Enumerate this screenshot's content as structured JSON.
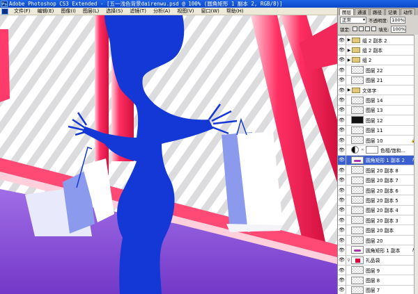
{
  "window": {
    "title": "Adobe Photoshop CS3 Extended - [五一浅色背景dairenwu.psd @ 100% (圆角矩形 1 副本 2, RGB/8)]",
    "app_icon": "ps-icon"
  },
  "menu": [
    "文件(F)",
    "编辑(E)",
    "图像(I)",
    "图层(L)",
    "选择(S)",
    "滤镜(T)",
    "分析(A)",
    "视图(V)",
    "窗口(W)",
    "帮助(H)"
  ],
  "panel": {
    "tabs": [
      "图层",
      "通道",
      "路径",
      "记录",
      "动作"
    ],
    "active_tab": "图层",
    "blend_mode": "正常",
    "opacity_label": "不透明度:",
    "opacity_value": "100%",
    "lock_label": "锁定:",
    "fill_label": "填充:",
    "fill_value": "100%"
  },
  "layers": [
    {
      "name": "组 2 副本 2",
      "kind": "group"
    },
    {
      "name": "组 2 副本",
      "kind": "group"
    },
    {
      "name": "组 2",
      "kind": "group"
    },
    {
      "name": "图层 22",
      "kind": "layer"
    },
    {
      "name": "图层 21",
      "kind": "layer"
    },
    {
      "name": "文体字",
      "kind": "group"
    },
    {
      "name": "图层 14",
      "kind": "layer"
    },
    {
      "name": "图层 13",
      "kind": "layer"
    },
    {
      "name": "图层 12",
      "kind": "masked"
    },
    {
      "name": "图层 11",
      "kind": "layer"
    },
    {
      "name": "图层 10",
      "kind": "layer-locked"
    },
    {
      "name": "色相/饱和...",
      "kind": "adjust"
    },
    {
      "name": "圆角矩形 1 副本 2",
      "kind": "shape",
      "selected": true,
      "fx": "fx"
    },
    {
      "name": "图层 20 副本 8",
      "kind": "layer"
    },
    {
      "name": "图层 20 副本 7",
      "kind": "layer"
    },
    {
      "name": "图层 20 副本 6",
      "kind": "layer"
    },
    {
      "name": "图层 20 副本 5",
      "kind": "layer"
    },
    {
      "name": "图层 20 副本 4",
      "kind": "layer"
    },
    {
      "name": "图层 20 副本 3",
      "kind": "layer"
    },
    {
      "name": "图层 20 副本",
      "kind": "layer"
    },
    {
      "name": "图层 20",
      "kind": "layer"
    },
    {
      "name": "圆角矩形 1 副本",
      "kind": "shape",
      "fx": "fx"
    },
    {
      "name": "礼品袋",
      "kind": "gift"
    },
    {
      "name": "图层 9",
      "kind": "layer"
    },
    {
      "name": "图层 8",
      "kind": "layer"
    },
    {
      "name": "图层 7",
      "kind": "layer"
    }
  ],
  "colors": {
    "silhouette": "#1438d6",
    "pink": "#f2285a",
    "purple": "#8b4fd8",
    "selection": "#3a5fd1"
  }
}
